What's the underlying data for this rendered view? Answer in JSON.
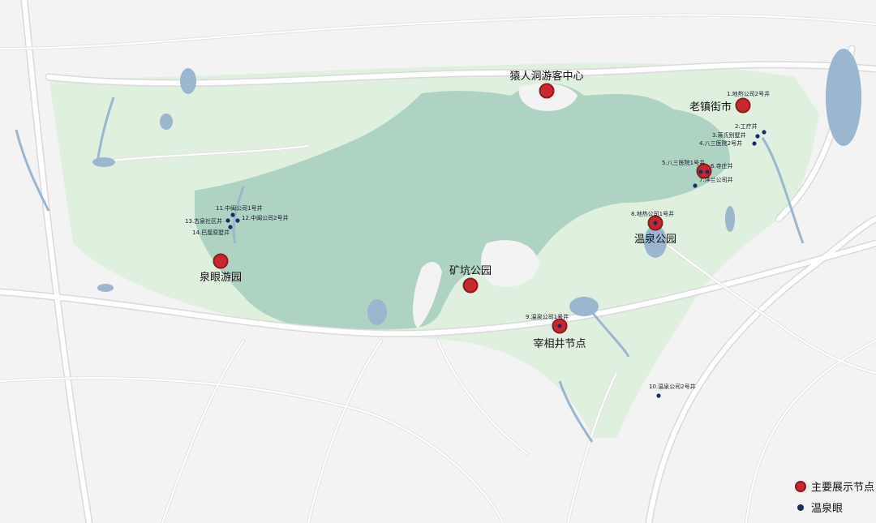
{
  "colors": {
    "background": "#f3f3f3",
    "road": "#ffffff",
    "road_edge": "#dcdcdc",
    "green": "#d9efda",
    "forest": "#a9d2c0",
    "water": "#9bb6cf",
    "major_node_fill": "#c8272d",
    "major_node_ring": "#8e1b1f",
    "hot_spring": "#1a2d6b"
  },
  "major_nodes": [
    {
      "id": "yuanrendong",
      "label": "猿人洞游客中心"
    },
    {
      "id": "laozhen",
      "label": "老镇街市"
    },
    {
      "id": "wenquan-park",
      "label": "温泉公园"
    },
    {
      "id": "kuangkeng",
      "label": "矿坑公园"
    },
    {
      "id": "quanyan",
      "label": "泉眼游园"
    },
    {
      "id": "xingxiang",
      "label": "宰相井节点"
    }
  ],
  "hot_springs": [
    {
      "id": "w1",
      "label": "1.地热公司2号井"
    },
    {
      "id": "w2",
      "label": "2.工疗井"
    },
    {
      "id": "w3",
      "label": "3.蒋氏别墅井"
    },
    {
      "id": "w4",
      "label": "4.八三医院2号井"
    },
    {
      "id": "w5",
      "label": "5.八三医院1号井"
    },
    {
      "id": "w6",
      "label": "6.寺庄井"
    },
    {
      "id": "w7",
      "label": "7.洋兰公司井"
    },
    {
      "id": "w8",
      "label": "8.地热公司1号井"
    },
    {
      "id": "w9",
      "label": "9.温泉公司1号井"
    },
    {
      "id": "w10",
      "label": "10.温泉公司2号井"
    },
    {
      "id": "w11",
      "label": "11.中闽公司1号井"
    },
    {
      "id": "w12",
      "label": "12.中闽公司2号井"
    },
    {
      "id": "w13",
      "label": "13.古泉社区井"
    },
    {
      "id": "w14",
      "label": "14.巴厘原墅井"
    }
  ],
  "legend": {
    "major": "主要展示节点",
    "spring": "温泉眼"
  }
}
